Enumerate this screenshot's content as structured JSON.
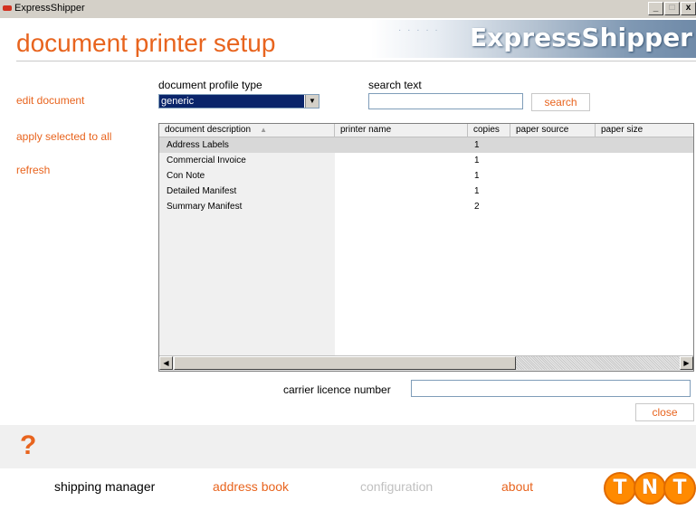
{
  "window": {
    "title": "ExpressShipper",
    "minimize": "_",
    "maximize": "□",
    "close": "x"
  },
  "header": {
    "page_title": "document printer setup",
    "brand": "ExpressShipper"
  },
  "sidebar": {
    "items": [
      {
        "label": "edit document"
      },
      {
        "label": "apply selected to all"
      },
      {
        "label": "refresh"
      }
    ]
  },
  "filters": {
    "profile_label": "document profile type",
    "profile_value": "generic",
    "search_label": "search text",
    "search_value": "",
    "search_button": "search"
  },
  "grid": {
    "columns": [
      "document description",
      "printer name",
      "copies",
      "paper source",
      "paper size"
    ],
    "sort_indicator": "▲",
    "rows": [
      {
        "description": "Address Labels",
        "printer": "",
        "copies": "1",
        "source": "",
        "size": ""
      },
      {
        "description": "Commercial Invoice",
        "printer": "",
        "copies": "1",
        "source": "",
        "size": ""
      },
      {
        "description": "Con Note",
        "printer": "",
        "copies": "1",
        "source": "",
        "size": ""
      },
      {
        "description": "Detailed Manifest",
        "printer": "",
        "copies": "1",
        "source": "",
        "size": ""
      },
      {
        "description": "Summary Manifest",
        "printer": "",
        "copies": "2",
        "source": "",
        "size": ""
      }
    ],
    "selected_row": 0
  },
  "carrier": {
    "label": "carrier licence number",
    "value": ""
  },
  "close_button": "close",
  "help_icon": "?",
  "nav": {
    "items": [
      {
        "label": "shipping manager",
        "color": "#000000"
      },
      {
        "label": "address book",
        "color": "#e8641e"
      },
      {
        "label": "configuration",
        "color": "#c0c0c0"
      },
      {
        "label": "about",
        "color": "#e8641e"
      }
    ]
  },
  "logo": {
    "letters": [
      "T",
      "N",
      "T"
    ]
  },
  "colors": {
    "accent": "#e8641e",
    "selection": "#0a246a",
    "row_selected": "#d8d8d8"
  }
}
